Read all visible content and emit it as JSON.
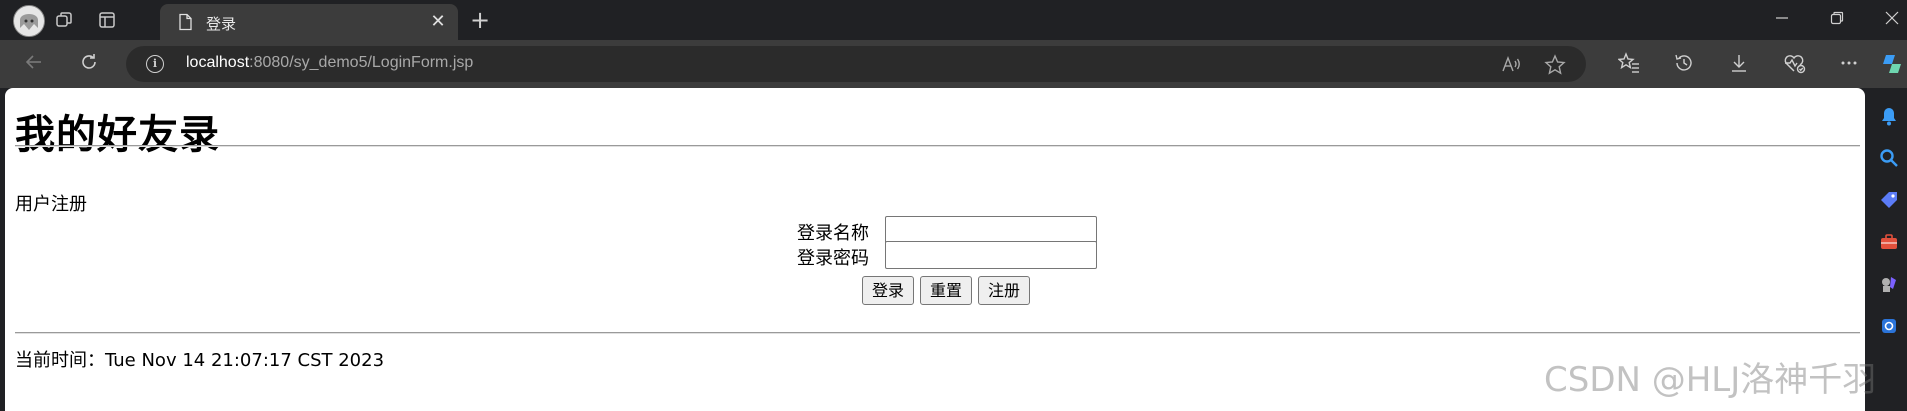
{
  "browser": {
    "tab": {
      "title": "登录"
    },
    "url": {
      "host": "localhost",
      "rest": ":8080/sy_demo5/LoginForm.jsp"
    },
    "icons": {
      "profile": "profile-avatar",
      "workspaces": "workspaces-icon",
      "tab_actions": "tab-actions-icon",
      "favicon": "page-icon",
      "close": "close-icon",
      "new_tab": "plus-icon",
      "minimize": "minimize-icon",
      "restore": "restore-icon",
      "window_close": "close-icon",
      "back": "back-arrow-icon",
      "refresh": "refresh-icon",
      "site_info": "info-icon",
      "read_aloud": "read-aloud-icon",
      "favorite": "star-icon",
      "favorites": "favorites-icon",
      "history": "history-icon",
      "downloads": "download-icon",
      "health": "browser-essentials-icon",
      "more": "more-icon",
      "copilot": "copilot-icon"
    }
  },
  "page": {
    "heading": "我的好友录",
    "register_link": "用户注册",
    "form": {
      "username_label": "登录名称",
      "password_label": "登录密码",
      "username_value": "",
      "password_value": "",
      "login_button": "登录",
      "reset_button": "重置",
      "register_button": "注册"
    },
    "time_label": "当前时间：",
    "time_value": "Tue Nov 14 21:07:17 CST 2023"
  },
  "watermark": "CSDN @HLJ洛神千羽",
  "colors": {
    "chrome_dark": "#202124",
    "toolbar": "#3c3c3c",
    "page_bg": "#ffffff",
    "accent_blue": "#3b9cf5"
  }
}
